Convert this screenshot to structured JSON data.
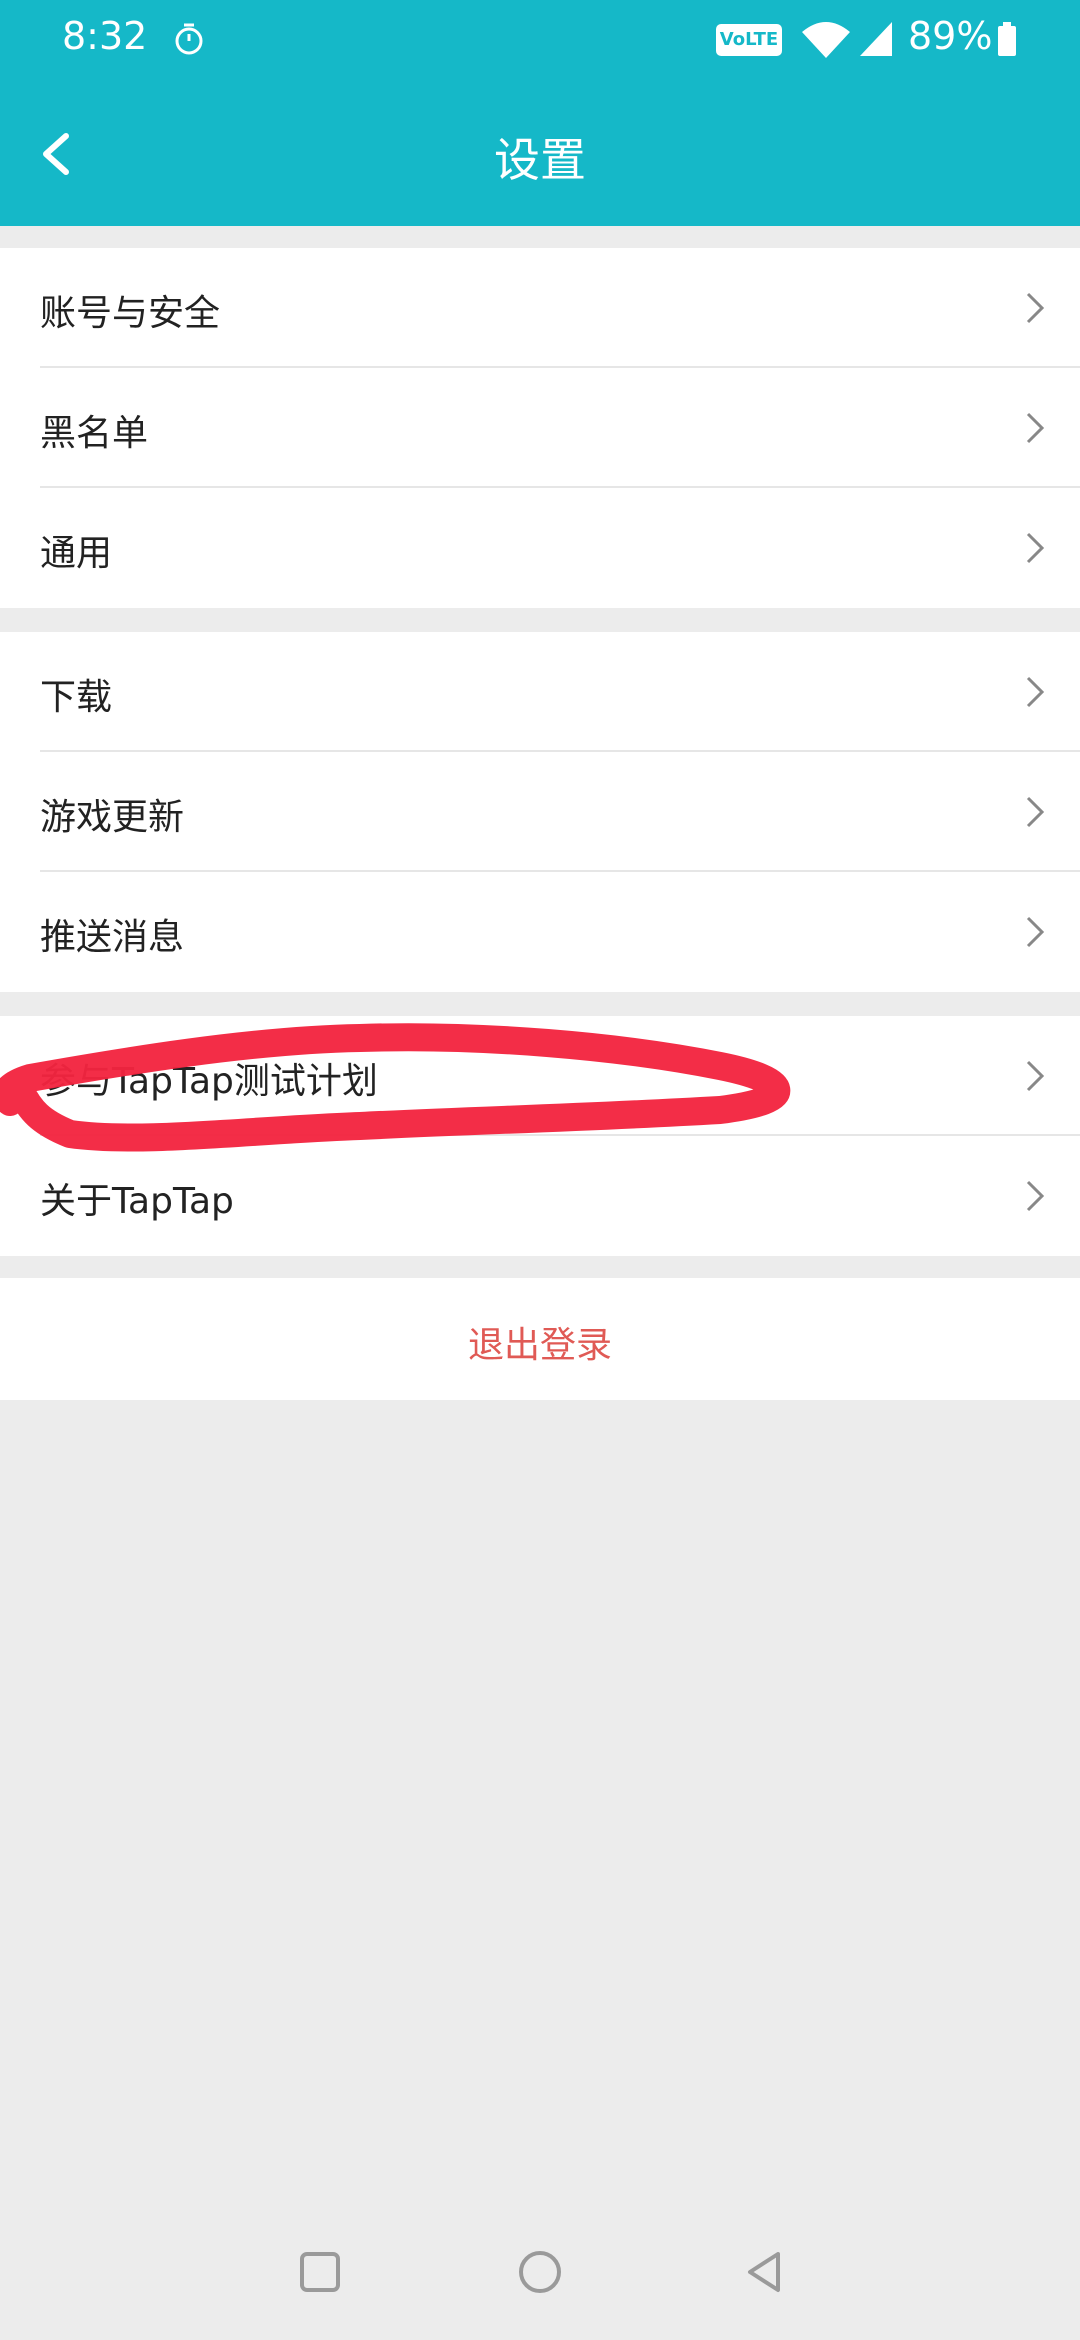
{
  "status_bar": {
    "time": "8:32",
    "volte": "VoLTE",
    "battery": "89%"
  },
  "header": {
    "title": "设置"
  },
  "groups": [
    {
      "items": [
        {
          "label": "账号与安全"
        },
        {
          "label": "黑名单"
        },
        {
          "label": "通用"
        }
      ]
    },
    {
      "items": [
        {
          "label": "下载"
        },
        {
          "label": "游戏更新"
        },
        {
          "label": "推送消息"
        }
      ]
    },
    {
      "items": [
        {
          "label": "参与TapTap测试计划"
        },
        {
          "label": "关于TapTap"
        }
      ]
    }
  ],
  "logout": {
    "label": "退出登录"
  },
  "colors": {
    "accent": "#15b8c8",
    "logout_text": "#e05a55",
    "annotation": "#f2243f",
    "background": "#ececec"
  }
}
